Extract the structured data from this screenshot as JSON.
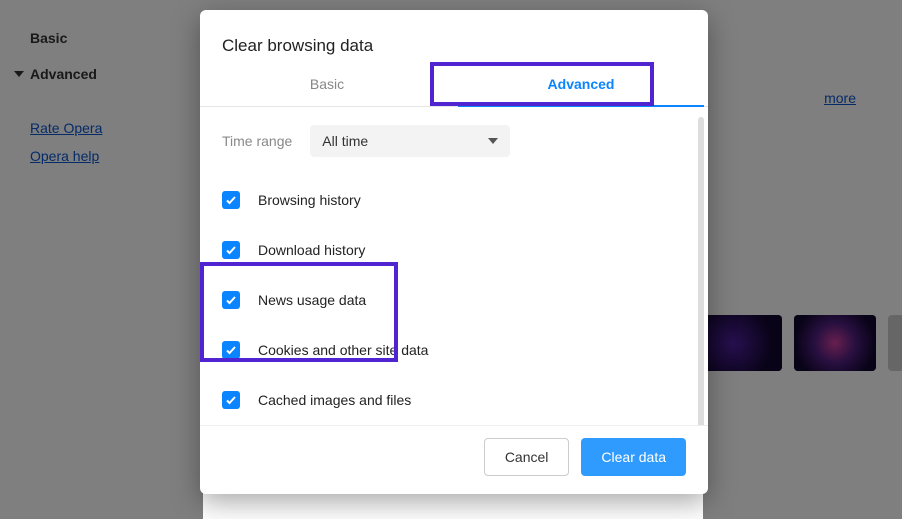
{
  "sidebar": {
    "basic_label": "Basic",
    "advanced_label": "Advanced",
    "links": {
      "rate": "Rate Opera",
      "help": "Opera help"
    }
  },
  "page": {
    "more_link": "more"
  },
  "modal": {
    "title": "Clear browsing data",
    "tabs": {
      "basic": "Basic",
      "advanced": "Advanced"
    },
    "time_range_label": "Time range",
    "time_range_value": "All time",
    "options": [
      {
        "key": "browsing_history",
        "label": "Browsing history",
        "checked": true
      },
      {
        "key": "download_history",
        "label": "Download history",
        "checked": true
      },
      {
        "key": "news_usage_data",
        "label": "News usage data",
        "checked": true
      },
      {
        "key": "cookies",
        "label": "Cookies and other site data",
        "checked": true
      },
      {
        "key": "cached",
        "label": "Cached images and files",
        "checked": true
      }
    ],
    "buttons": {
      "cancel": "Cancel",
      "clear": "Clear data"
    }
  }
}
